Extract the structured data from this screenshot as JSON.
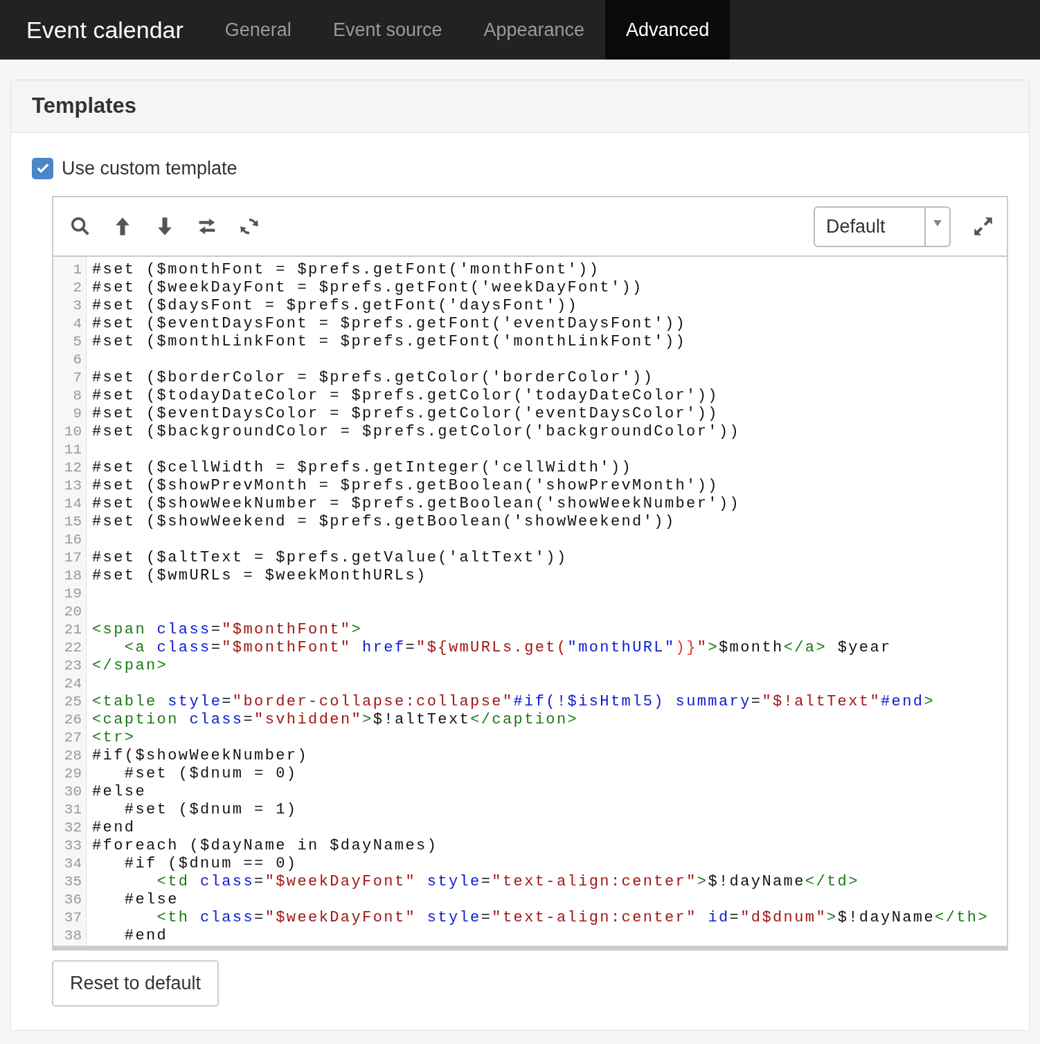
{
  "app_title": "Event calendar",
  "tabs": [
    {
      "label": "General",
      "selected": false
    },
    {
      "label": "Event source",
      "selected": false
    },
    {
      "label": "Appearance",
      "selected": false
    },
    {
      "label": "Advanced",
      "selected": true
    }
  ],
  "panel": {
    "title": "Templates",
    "use_custom_template": {
      "label": "Use custom template",
      "checked": true
    },
    "editor": {
      "theme_select": {
        "value": "Default"
      },
      "lines": [
        {
          "number": "1",
          "tokens": [
            {
              "kind": "plain",
              "text": "#set ($monthFont = $prefs.getFont('monthFont'))"
            }
          ]
        },
        {
          "number": "2",
          "tokens": [
            {
              "kind": "plain",
              "text": "#set ($weekDayFont = $prefs.getFont('weekDayFont'))"
            }
          ]
        },
        {
          "number": "3",
          "tokens": [
            {
              "kind": "plain",
              "text": "#set ($daysFont = $prefs.getFont('daysFont'))"
            }
          ]
        },
        {
          "number": "4",
          "tokens": [
            {
              "kind": "plain",
              "text": "#set ($eventDaysFont = $prefs.getFont('eventDaysFont'))"
            }
          ]
        },
        {
          "number": "5",
          "tokens": [
            {
              "kind": "plain",
              "text": "#set ($monthLinkFont = $prefs.getFont('monthLinkFont'))"
            }
          ]
        },
        {
          "number": "6"
        },
        {
          "number": "7",
          "tokens": [
            {
              "kind": "plain",
              "text": "#set ($borderColor = $prefs.getColor('borderColor'))"
            }
          ]
        },
        {
          "number": "8",
          "tokens": [
            {
              "kind": "plain",
              "text": "#set ($todayDateColor = $prefs.getColor('todayDateColor'))"
            }
          ]
        },
        {
          "number": "9",
          "tokens": [
            {
              "kind": "plain",
              "text": "#set ($eventDaysColor = $prefs.getColor('eventDaysColor'))"
            }
          ]
        },
        {
          "number": "10",
          "tokens": [
            {
              "kind": "plain",
              "text": "#set ($backgroundColor = $prefs.getColor('backgroundColor'))"
            }
          ]
        },
        {
          "number": "11"
        },
        {
          "number": "12",
          "tokens": [
            {
              "kind": "plain",
              "text": "#set ($cellWidth = $prefs.getInteger('cellWidth'))"
            }
          ]
        },
        {
          "number": "13",
          "tokens": [
            {
              "kind": "plain",
              "text": "#set ($showPrevMonth = $prefs.getBoolean('showPrevMonth'))"
            }
          ]
        },
        {
          "number": "14",
          "tokens": [
            {
              "kind": "plain",
              "text": "#set ($showWeekNumber = $prefs.getBoolean('showWeekNumber'))"
            }
          ]
        },
        {
          "number": "15",
          "tokens": [
            {
              "kind": "plain",
              "text": "#set ($showWeekend = $prefs.getBoolean('showWeekend'))"
            }
          ]
        },
        {
          "number": "16"
        },
        {
          "number": "17",
          "tokens": [
            {
              "kind": "plain",
              "text": "#set ($altText = $prefs.getValue('altText'))"
            }
          ]
        },
        {
          "number": "18",
          "tokens": [
            {
              "kind": "plain",
              "text": "#set ($wmURLs = $weekMonthURLs)"
            }
          ]
        },
        {
          "number": "19"
        },
        {
          "number": "20"
        },
        {
          "number": "21",
          "tokens": [
            {
              "kind": "tag",
              "text": "<span"
            },
            {
              "kind": "attr",
              "text": " class"
            },
            {
              "kind": "plain",
              "text": "="
            },
            {
              "kind": "string",
              "text": "\"$monthFont\""
            },
            {
              "kind": "tag",
              "text": ">"
            }
          ]
        },
        {
          "number": "22",
          "tokens": [
            {
              "kind": "tag",
              "text": "   <a"
            },
            {
              "kind": "attr",
              "text": " class"
            },
            {
              "kind": "plain",
              "text": "="
            },
            {
              "kind": "string",
              "text": "\"$monthFont\""
            },
            {
              "kind": "attr",
              "text": " href"
            },
            {
              "kind": "plain",
              "text": "="
            },
            {
              "kind": "string",
              "text": "\"${wmURLs.get("
            },
            {
              "kind": "attr",
              "text": "\"monthURL\""
            },
            {
              "kind": "bracket",
              "text": ")}"
            },
            {
              "kind": "string",
              "text": "\""
            },
            {
              "kind": "tag",
              "text": ">"
            },
            {
              "kind": "plain",
              "text": "$month"
            },
            {
              "kind": "tag",
              "text": "</a>"
            },
            {
              "kind": "plain",
              "text": " $year"
            }
          ]
        },
        {
          "number": "23",
          "tokens": [
            {
              "kind": "tag",
              "text": "</span>"
            }
          ]
        },
        {
          "number": "24"
        },
        {
          "number": "25",
          "tokens": [
            {
              "kind": "tag",
              "text": "<table"
            },
            {
              "kind": "attr",
              "text": " style"
            },
            {
              "kind": "plain",
              "text": "="
            },
            {
              "kind": "string",
              "text": "\"border-collapse:collapse\""
            },
            {
              "kind": "attr",
              "text": "#if(!$isHtml5) summary"
            },
            {
              "kind": "plain",
              "text": "="
            },
            {
              "kind": "string",
              "text": "\"$!altText\""
            },
            {
              "kind": "attr",
              "text": "#end"
            },
            {
              "kind": "tag",
              "text": ">"
            }
          ]
        },
        {
          "number": "26",
          "tokens": [
            {
              "kind": "tag",
              "text": "<caption"
            },
            {
              "kind": "attr",
              "text": " class"
            },
            {
              "kind": "plain",
              "text": "="
            },
            {
              "kind": "string",
              "text": "\"svhidden\""
            },
            {
              "kind": "tag",
              "text": ">"
            },
            {
              "kind": "plain",
              "text": "$!altText"
            },
            {
              "kind": "tag",
              "text": "</caption>"
            }
          ]
        },
        {
          "number": "27",
          "tokens": [
            {
              "kind": "tag",
              "text": "<tr>"
            }
          ]
        },
        {
          "number": "28",
          "tokens": [
            {
              "kind": "plain",
              "text": "#if($showWeekNumber)"
            }
          ]
        },
        {
          "number": "29",
          "tokens": [
            {
              "kind": "plain",
              "text": "   #set ($dnum = 0)"
            }
          ]
        },
        {
          "number": "30",
          "tokens": [
            {
              "kind": "plain",
              "text": "#else"
            }
          ]
        },
        {
          "number": "31",
          "tokens": [
            {
              "kind": "plain",
              "text": "   #set ($dnum = 1)"
            }
          ]
        },
        {
          "number": "32",
          "tokens": [
            {
              "kind": "plain",
              "text": "#end"
            }
          ]
        },
        {
          "number": "33",
          "tokens": [
            {
              "kind": "plain",
              "text": "#foreach ($dayName in $dayNames)"
            }
          ]
        },
        {
          "number": "34",
          "tokens": [
            {
              "kind": "plain",
              "text": "   #if ($dnum == 0)"
            }
          ]
        },
        {
          "number": "35",
          "tokens": [
            {
              "kind": "tag",
              "text": "      <td"
            },
            {
              "kind": "attr",
              "text": " class"
            },
            {
              "kind": "plain",
              "text": "="
            },
            {
              "kind": "string",
              "text": "\"$weekDayFont\""
            },
            {
              "kind": "attr",
              "text": " style"
            },
            {
              "kind": "plain",
              "text": "="
            },
            {
              "kind": "string",
              "text": "\"text-align:center\""
            },
            {
              "kind": "tag",
              "text": ">"
            },
            {
              "kind": "plain",
              "text": "$!dayName"
            },
            {
              "kind": "tag",
              "text": "</td>"
            }
          ]
        },
        {
          "number": "36",
          "tokens": [
            {
              "kind": "plain",
              "text": "   #else"
            }
          ]
        },
        {
          "number": "37",
          "tokens": [
            {
              "kind": "tag",
              "text": "      <th"
            },
            {
              "kind": "attr",
              "text": " class"
            },
            {
              "kind": "plain",
              "text": "="
            },
            {
              "kind": "string",
              "text": "\"$weekDayFont\""
            },
            {
              "kind": "attr",
              "text": " style"
            },
            {
              "kind": "plain",
              "text": "="
            },
            {
              "kind": "string",
              "text": "\"text-align:center\""
            },
            {
              "kind": "attr",
              "text": " id"
            },
            {
              "kind": "plain",
              "text": "="
            },
            {
              "kind": "string",
              "text": "\"d$dnum\""
            },
            {
              "kind": "tag",
              "text": ">"
            },
            {
              "kind": "plain",
              "text": "$!dayName"
            },
            {
              "kind": "tag",
              "text": "</th>"
            }
          ]
        },
        {
          "number": "38",
          "tokens": [
            {
              "kind": "plain",
              "text": "   #end"
            }
          ]
        }
      ]
    },
    "reset_button": "Reset to default"
  }
}
